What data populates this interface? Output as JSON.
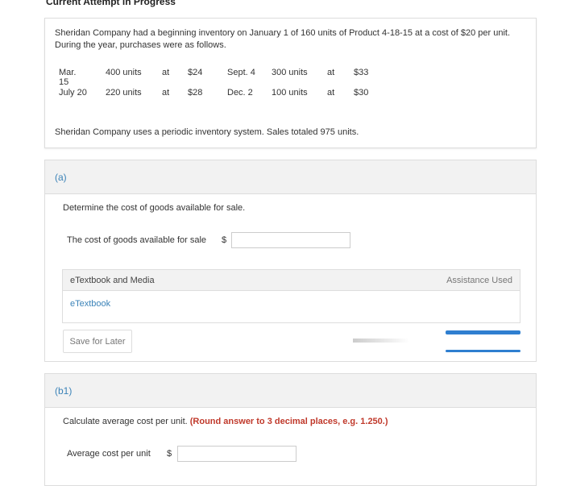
{
  "heading": "Current Attempt in Progress",
  "problem": {
    "intro_line1": "Sheridan Company had a beginning inventory on January 1 of 160 units of Product 4-18-15 at a cost of $20 per unit.",
    "intro_line2": "During the year, purchases were as follows.",
    "purchases": [
      {
        "date": "Mar. 15",
        "units": "400 units",
        "at": "at",
        "cost": "$24"
      },
      {
        "date": "July 20",
        "units": "220 units",
        "at": "at",
        "cost": "$28"
      },
      {
        "date": "Sept. 4",
        "units": "300 units",
        "at": "at",
        "cost": "$33"
      },
      {
        "date": "Dec. 2",
        "units": "100 units",
        "at": "at",
        "cost": "$30"
      }
    ],
    "footer": "Sheridan Company uses a periodic inventory system. Sales totaled 975 units."
  },
  "part_a": {
    "label": "(a)",
    "instruction": "Determine the cost of goods available for sale.",
    "field_label": "The cost of goods available for sale",
    "currency": "$",
    "value": "",
    "media_title": "eTextbook and Media",
    "assistance": "Assistance Used",
    "etextbook_link": "eTextbook",
    "save_label": "Save for Later"
  },
  "part_b1": {
    "label": "(b1)",
    "instruction": "Calculate average cost per unit.",
    "instruction_note": "(Round answer to 3 decimal places, e.g. 1.250.)",
    "field_label": "Average cost per unit",
    "currency": "$",
    "value": ""
  },
  "colors": {
    "link": "#3b83b8",
    "accent_bar": "#2f7fd0",
    "note": "#c0392b"
  }
}
